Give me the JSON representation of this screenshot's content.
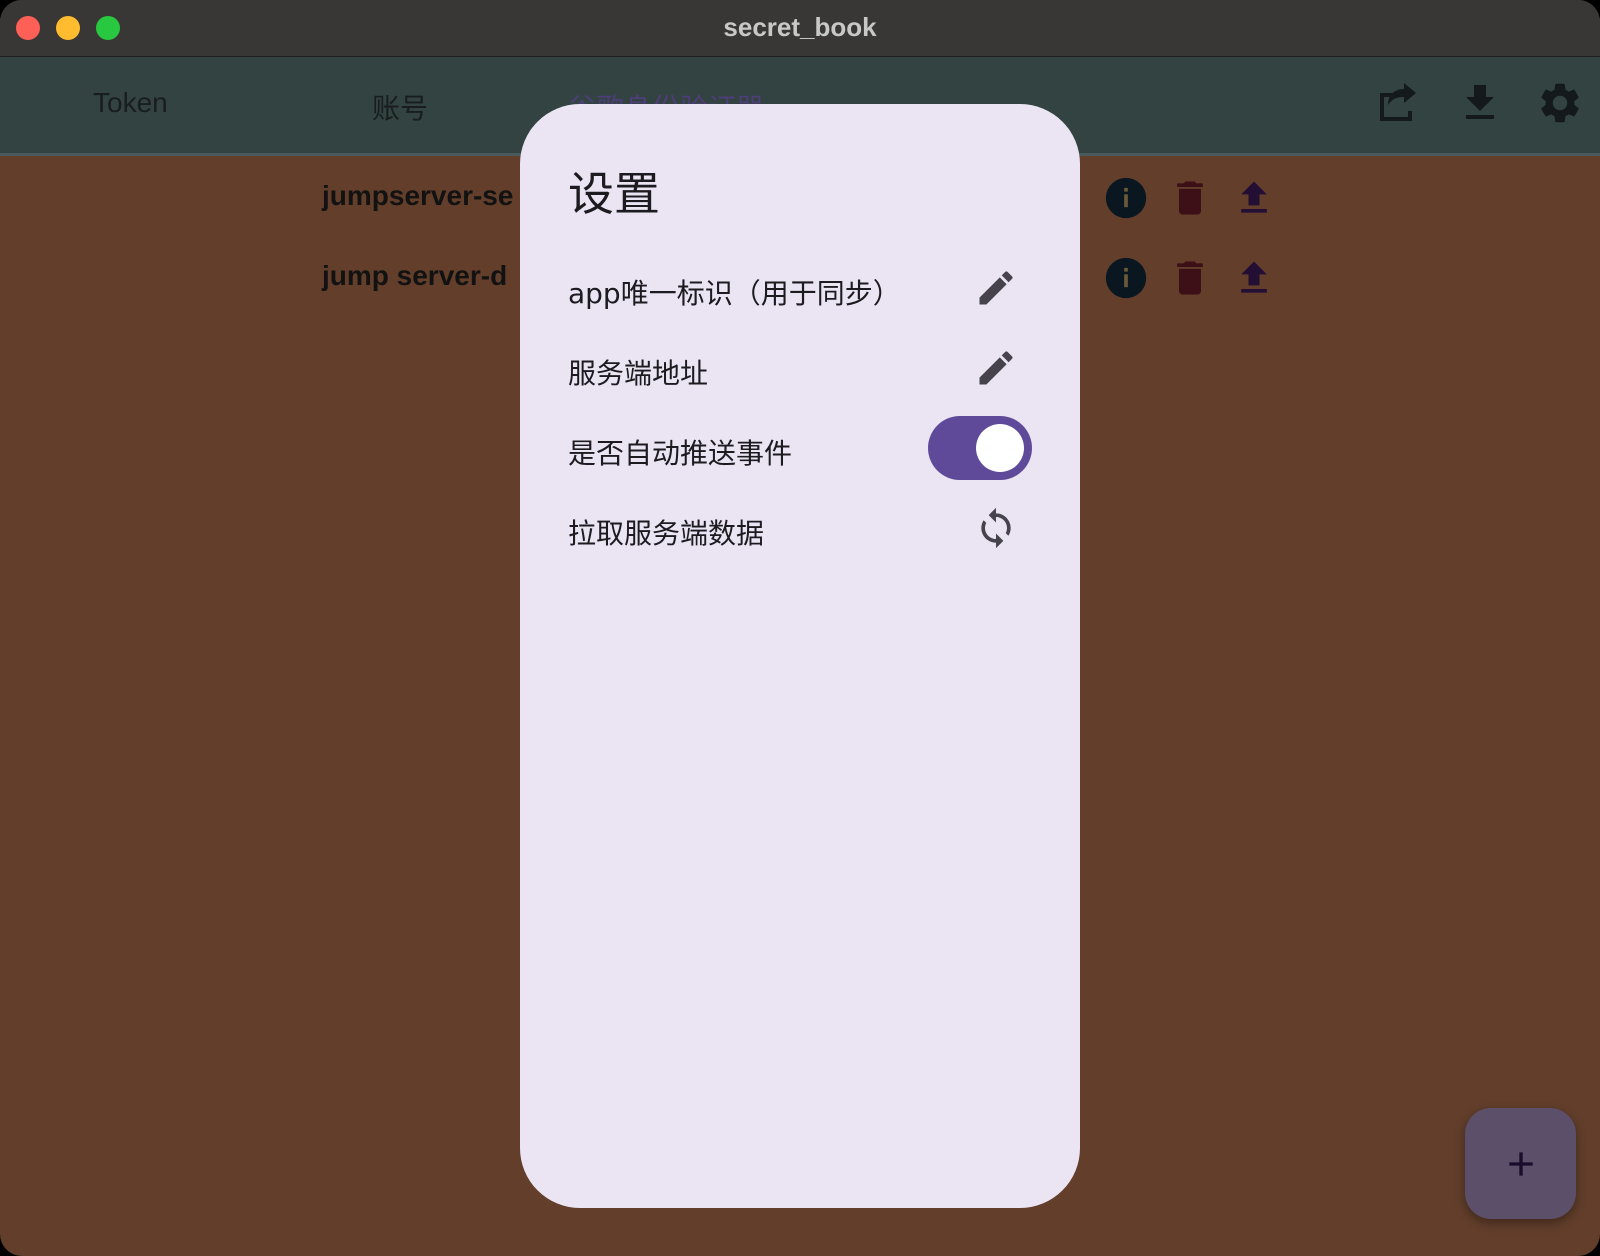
{
  "window": {
    "title": "secret_book"
  },
  "tabs": [
    {
      "label": "Token"
    },
    {
      "label": "账号"
    },
    {
      "label": "谷歌身份验证器"
    }
  ],
  "toolbar": {
    "share_icon": "share-icon",
    "download_icon": "download-icon",
    "settings_icon": "gear-icon"
  },
  "list": {
    "items": [
      {
        "name": "jumpserver-se"
      },
      {
        "name": "jump server-d"
      }
    ]
  },
  "dialog": {
    "title": "设置",
    "rows": [
      {
        "label": "app唯一标识（用于同步）",
        "control": "edit"
      },
      {
        "label": "服务端地址",
        "control": "edit"
      },
      {
        "label": "是否自动推送事件",
        "control": "toggle",
        "value": true
      },
      {
        "label": "拉取服务端数据",
        "control": "sync"
      }
    ]
  },
  "colors": {
    "accent": "#5f4a99",
    "background": "#623e2b",
    "appbar": "#324341",
    "dialog": "#eae4f3"
  }
}
